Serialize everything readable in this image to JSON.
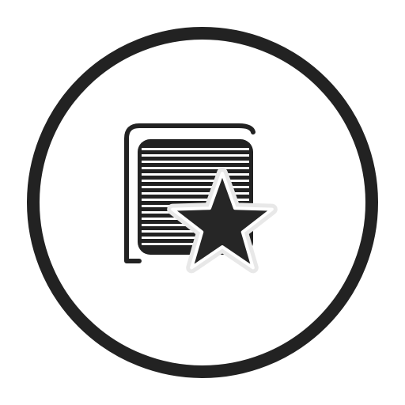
{
  "icon": {
    "name": "favorite-document-icon",
    "parts": [
      "outer-ring",
      "back-document-frame",
      "lined-document",
      "star"
    ]
  },
  "colors": {
    "background": "#ffffff",
    "stroke": "#222222",
    "star_fill": "#262626",
    "star_outline": "#e8e8e8"
  }
}
